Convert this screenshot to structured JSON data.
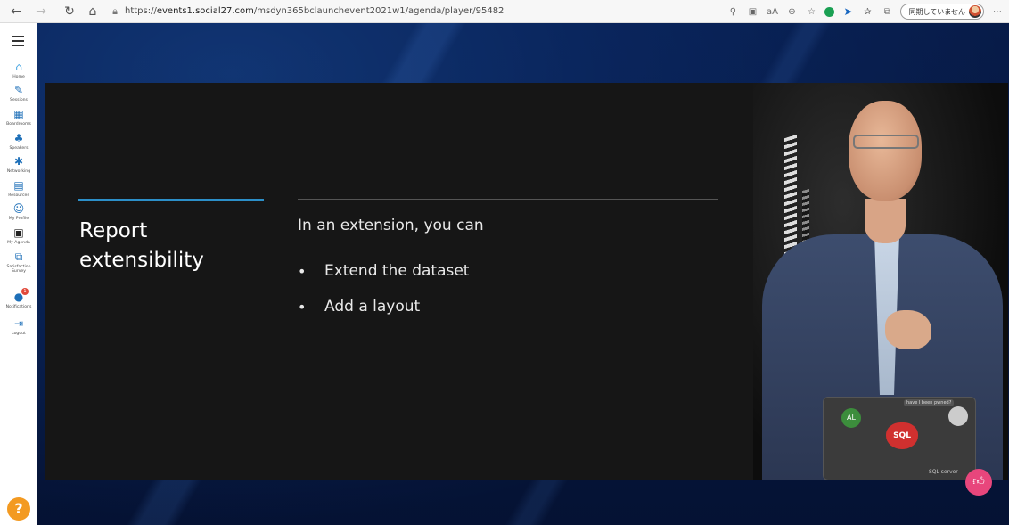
{
  "browser": {
    "url_prefix": "https://",
    "url_host": "events1.social27.com",
    "url_path": "/msdyn365bclaunchevent2021w1/agenda/player/95482",
    "profile_label": "同期していません"
  },
  "sidebar": {
    "items": [
      {
        "label": "Home",
        "icon": "home-icon"
      },
      {
        "label": "Sessions",
        "icon": "pencil-icon"
      },
      {
        "label": "Boardrooms",
        "icon": "calendar-grid-icon"
      },
      {
        "label": "Speakers",
        "icon": "speaker-icon"
      },
      {
        "label": "Networking",
        "icon": "network-icon"
      },
      {
        "label": "Resources",
        "icon": "document-icon"
      },
      {
        "label": "My Profile",
        "icon": "profile-icon"
      },
      {
        "label": "My Agenda",
        "icon": "agenda-icon"
      },
      {
        "label": "Satisfaction Survey",
        "icon": "survey-icon"
      },
      {
        "label": "Notifications",
        "icon": "bell-icon",
        "badge": "1"
      },
      {
        "label": "Logout",
        "icon": "logout-icon"
      }
    ],
    "help_label": "?"
  },
  "slide": {
    "title": "Report extensibility",
    "intro": "In an extension, you can",
    "bullets": [
      "Extend the dataset",
      "Add a layout"
    ]
  },
  "camera": {
    "sticker_sql": "SQL",
    "sticker_al": "AL",
    "sticker_tag": "have I been pwned?",
    "laptop_label": "SQL server"
  },
  "colors": {
    "accent_rule": "#2c8fc8",
    "like_button": "#e8467c",
    "help_button": "#f39a21",
    "sidebar_icon": "#1d6fb8"
  }
}
